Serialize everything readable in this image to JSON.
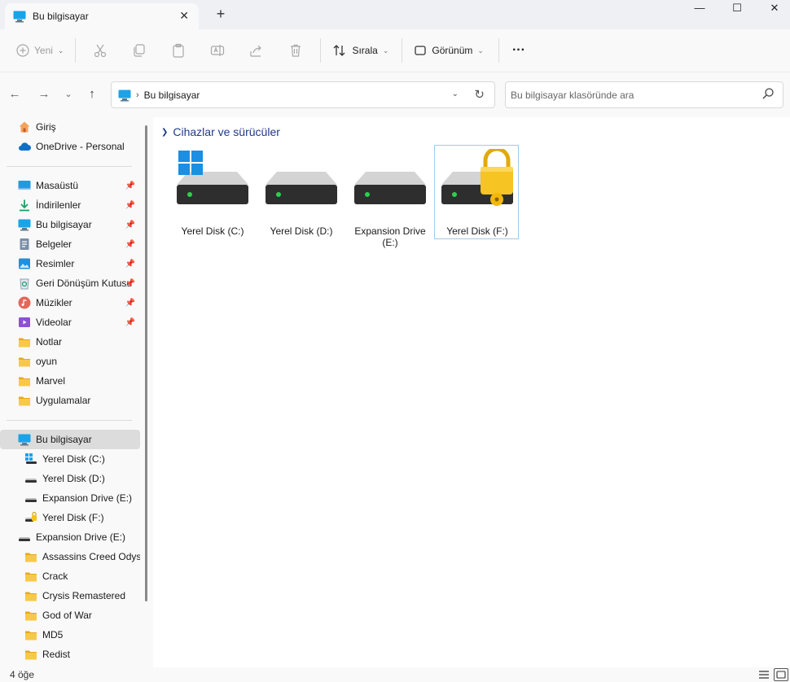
{
  "window": {
    "tab_title": "Bu bilgisayar",
    "tab_close_glyph": "✕",
    "new_tab_glyph": "+",
    "minimize_glyph": "—",
    "maximize_glyph": "☐",
    "close_glyph": "✕"
  },
  "toolbar": {
    "new_label": "Yeni",
    "sort_label": "Sırala",
    "view_label": "Görünüm",
    "more_glyph": "···"
  },
  "address": {
    "path": "Bu bilgisayar",
    "search_placeholder": "Bu bilgisayar klasöründe ara"
  },
  "nav": {
    "home": "Giriş",
    "onedrive": "OneDrive - Personal",
    "quick": [
      {
        "label": "Masaüstü",
        "icon": "desktop-icon"
      },
      {
        "label": "İndirilenler",
        "icon": "download-icon"
      },
      {
        "label": "Bu bilgisayar",
        "icon": "computer-icon"
      },
      {
        "label": "Belgeler",
        "icon": "documents-icon"
      },
      {
        "label": "Resimler",
        "icon": "pictures-icon"
      },
      {
        "label": "Geri Dönüşüm Kutusu",
        "icon": "recycle-bin-icon"
      },
      {
        "label": "Müzikler",
        "icon": "music-icon"
      },
      {
        "label": "Videolar",
        "icon": "videos-icon"
      },
      {
        "label": "Notlar",
        "icon": "folder-icon"
      },
      {
        "label": "oyun",
        "icon": "folder-icon"
      },
      {
        "label": "Marvel",
        "icon": "folder-icon"
      },
      {
        "label": "Uygulamalar",
        "icon": "folder-icon"
      }
    ],
    "this_pc": "Bu bilgisayar",
    "drives": [
      {
        "label": "Yerel Disk (C:)",
        "icon": "windows-drive-icon"
      },
      {
        "label": "Yerel Disk (D:)",
        "icon": "drive-icon"
      },
      {
        "label": "Expansion Drive (E:)",
        "icon": "drive-icon"
      },
      {
        "label": "Yerel Disk (F:)",
        "icon": "locked-drive-icon"
      }
    ],
    "expansion": "Expansion Drive (E:)",
    "expansion_folders": [
      {
        "label": "Assassins Creed Odyssey"
      },
      {
        "label": "Crack"
      },
      {
        "label": "Crysis Remastered"
      },
      {
        "label": "God of War"
      },
      {
        "label": "MD5"
      },
      {
        "label": "Redist"
      }
    ]
  },
  "content": {
    "group_title": "Cihazlar ve sürücüler",
    "items": [
      {
        "label": "Yerel Disk (C:)",
        "icon": "windows-drive-icon"
      },
      {
        "label": "Yerel Disk (D:)",
        "icon": "drive-icon"
      },
      {
        "label": "Expansion Drive (E:)",
        "icon": "drive-icon"
      },
      {
        "label": "Yerel Disk (F:)",
        "icon": "locked-drive-icon"
      }
    ]
  },
  "status": {
    "item_count": "4 öğe"
  },
  "colors": {
    "accent": "#1f3a8a",
    "selection_border": "#9fcbe8",
    "folder": "#f7c948",
    "led": "#29d14a"
  }
}
